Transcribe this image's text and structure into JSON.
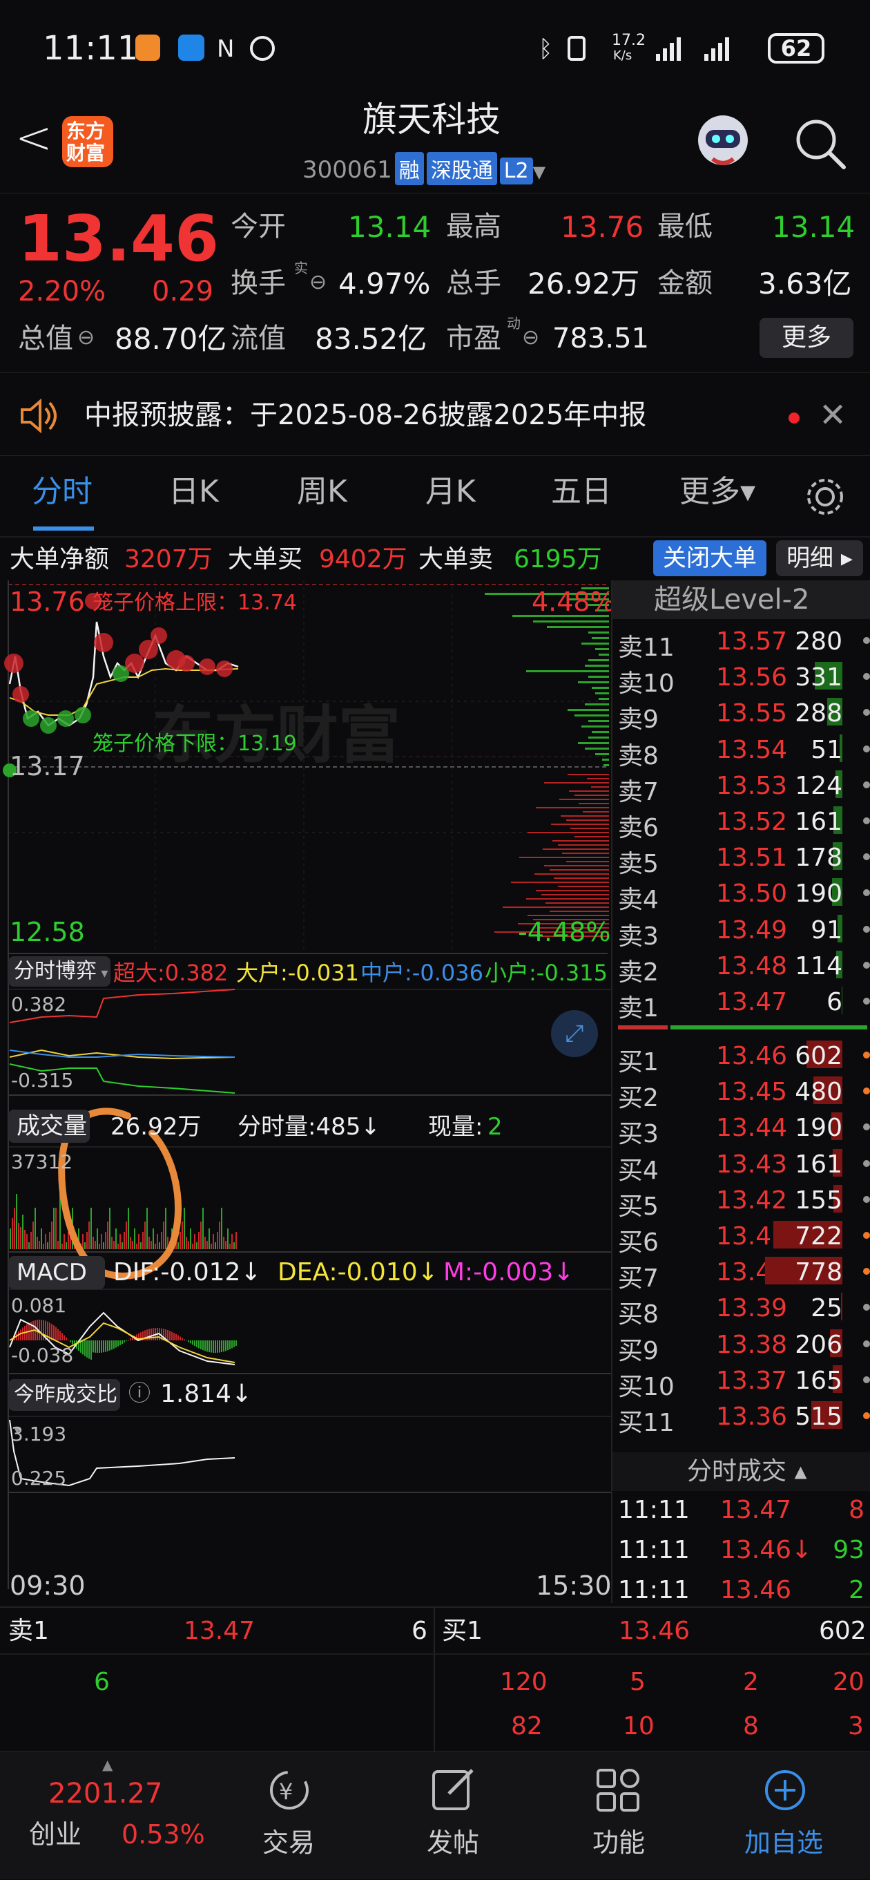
{
  "status": {
    "time": "11:11",
    "net_speed_top": "17.2",
    "net_speed_bottom": "K/s",
    "battery": "62"
  },
  "header": {
    "back": "<",
    "logo_line1": "东方",
    "logo_line2": "财富",
    "stock_name": "旗天科技",
    "code": "300061",
    "tag_rong": "融",
    "tag_sgt": "深股通",
    "tag_l2": "L2"
  },
  "quote": {
    "price": "13.46",
    "pct": "2.20%",
    "change": "0.29",
    "open_label": "今开",
    "open": "13.14",
    "high_label": "最高",
    "high": "13.76",
    "low_label": "最低",
    "low": "13.14",
    "turnover_label": "换手",
    "turnover": "4.97%",
    "volume_label": "总手",
    "volume": "26.92万",
    "amount_label": "金额",
    "amount": "3.63亿",
    "mktcap_label": "总值",
    "mktcap": "88.70亿",
    "float_label": "流值",
    "float": "83.52亿",
    "pe_label": "市盈",
    "pe_sup": "动",
    "pe": "783.51",
    "more": "更多",
    "turnover_sup": "实"
  },
  "notice": {
    "text": "中报预披露：于2025-08-26披露2025年中报"
  },
  "tabs": [
    {
      "label": "分时",
      "active": true
    },
    {
      "label": "日K"
    },
    {
      "label": "周K"
    },
    {
      "label": "月K"
    },
    {
      "label": "五日"
    },
    {
      "label": "更多▾"
    }
  ],
  "bigorder": {
    "net_label": "大单净额",
    "net": "3207万",
    "buy_label": "大单买",
    "buy": "9402万",
    "sell_label": "大单卖",
    "sell": "6195万",
    "close_btn": "关闭大单",
    "detail_btn": "明细 ▸"
  },
  "chart": {
    "price_high": "13.76",
    "price_mid": "13.17",
    "price_low": "12.58",
    "pct_high": "4.48%",
    "pct_low": "-4.48%",
    "upper_limit": "笼子价格上限：13.74",
    "lower_limit": "笼子价格下限：13.19",
    "watermark": "东方财富",
    "game_label": "分时博弈",
    "game_cd": "超大:0.382",
    "game_dh": "大户:-0.031",
    "game_zh": "中户:-0.036",
    "game_xh": "小户:-0.315",
    "game_top": "0.382",
    "game_bot": "-0.315",
    "vol_label": "成交量",
    "vol_total": "26.92万",
    "vol_fs": "分时量:485↓",
    "vol_now_label": "现量:",
    "vol_now": "2",
    "vol_max": "37312",
    "macd_label": "MACD",
    "dif": "DIF:-0.012↓",
    "dea": "DEA:-0.010↓",
    "m": "M:-0.003↓",
    "macd_top": "0.081",
    "macd_bot": "-0.038",
    "ratio_label": "今昨成交比",
    "ratio_val": "1.814↓",
    "ratio_top": "3.193",
    "ratio_bot": "0.225",
    "time_start": "09:30",
    "time_end": "15:30"
  },
  "level2": {
    "title": "超级Level-2",
    "asks": [
      {
        "l": "卖11",
        "p": "13.57",
        "v": "280",
        "w": 0
      },
      {
        "l": "卖10",
        "p": "13.56",
        "v": "331",
        "w": 40
      },
      {
        "l": "卖9",
        "p": "13.55",
        "v": "288",
        "w": 22
      },
      {
        "l": "卖8",
        "p": "13.54",
        "v": "51",
        "w": 4
      },
      {
        "l": "卖7",
        "p": "13.53",
        "v": "124",
        "w": 10
      },
      {
        "l": "卖6",
        "p": "13.52",
        "v": "161",
        "w": 13
      },
      {
        "l": "卖5",
        "p": "13.51",
        "v": "178",
        "w": 14
      },
      {
        "l": "卖4",
        "p": "13.50",
        "v": "190",
        "w": 15
      },
      {
        "l": "卖3",
        "p": "13.49",
        "v": "91",
        "w": 7
      },
      {
        "l": "卖2",
        "p": "13.48",
        "v": "114",
        "w": 9
      },
      {
        "l": "卖1",
        "p": "13.47",
        "v": "6",
        "w": 1
      }
    ],
    "bids": [
      {
        "l": "买1",
        "p": "13.46",
        "v": "602",
        "w": 52
      },
      {
        "l": "买2",
        "p": "13.45",
        "v": "480",
        "w": 42
      },
      {
        "l": "买3",
        "p": "13.44",
        "v": "190",
        "w": 16
      },
      {
        "l": "买4",
        "p": "13.43",
        "v": "161",
        "w": 14
      },
      {
        "l": "买5",
        "p": "13.42",
        "v": "155",
        "w": 13
      },
      {
        "l": "买6",
        "p": "13.41",
        "v": "722",
        "w": 100
      },
      {
        "l": "买7",
        "p": "13.40",
        "v": "778",
        "w": 112
      },
      {
        "l": "买8",
        "p": "13.39",
        "v": "25",
        "w": 2
      },
      {
        "l": "买9",
        "p": "13.38",
        "v": "206",
        "w": 18
      },
      {
        "l": "买10",
        "p": "13.37",
        "v": "165",
        "w": 14
      },
      {
        "l": "买11",
        "p": "13.36",
        "v": "515",
        "w": 45
      }
    ],
    "trade_title": "分时成交 ▴",
    "trades": [
      {
        "t": "11:11",
        "p": "13.47",
        "v": "8"
      },
      {
        "t": "11:11",
        "p": "13.46↓",
        "v": "93"
      },
      {
        "t": "11:11",
        "p": "13.46",
        "v": "2"
      }
    ]
  },
  "bottom": {
    "ask_label": "卖1",
    "ask_price": "13.47",
    "ask_vol": "6",
    "ask_queue": "6",
    "bid_label": "买1",
    "bid_price": "13.46",
    "bid_vol": "602",
    "bid_queue_row1": [
      "120",
      "5",
      "2",
      "20"
    ],
    "bid_queue_row2": [
      "82",
      "10",
      "8",
      "3"
    ]
  },
  "nav": {
    "index_value": "2201.27",
    "index_name": "创业",
    "index_pct": "0.53%",
    "trade": "交易",
    "post": "发帖",
    "func": "功能",
    "add": "加自选"
  },
  "colors": {
    "up": "#f03434",
    "down": "#2fce2f",
    "accent": "#3a8fe8",
    "annotation": "#e8893a"
  }
}
